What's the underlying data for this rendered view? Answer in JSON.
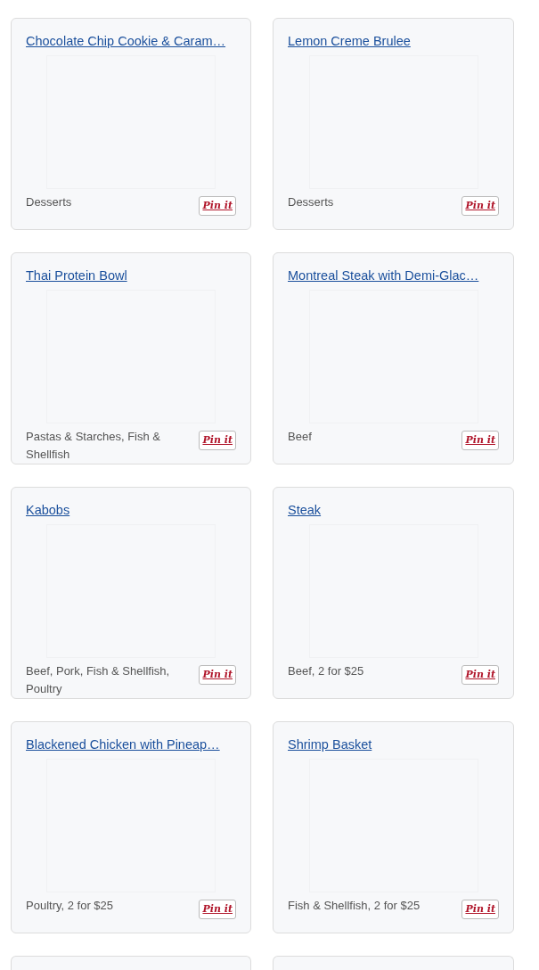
{
  "cards": [
    {
      "kind": "recipe",
      "title": "Chocolate Chip Cookie & Caram…",
      "category": "Desserts",
      "pin_label": "Pin it"
    },
    {
      "kind": "recipe",
      "title": "Lemon Creme Brulee",
      "category": "Desserts",
      "pin_label": "Pin it"
    },
    {
      "kind": "recipe",
      "title": "Thai Protein Bowl",
      "category": "Pastas & Starches, Fish & Shellfish",
      "pin_label": "Pin it"
    },
    {
      "kind": "recipe",
      "title": "Montreal Steak with Demi-Glac…",
      "category": "Beef",
      "pin_label": "Pin it"
    },
    {
      "kind": "recipe",
      "title": "Kabobs",
      "category": "Beef, Pork, Fish & Shellfish, Poultry",
      "pin_label": "Pin it"
    },
    {
      "kind": "recipe",
      "title": "Steak",
      "category": "Beef, 2 for $25",
      "pin_label": "Pin it"
    },
    {
      "kind": "recipe",
      "title": "Blackened Chicken with Pineap…",
      "category": "Poultry, 2 for $25",
      "pin_label": "Pin it"
    },
    {
      "kind": "recipe",
      "title": "Shrimp Basket",
      "category": "Fish & Shellfish, 2 for $25",
      "pin_label": "Pin it"
    },
    {
      "kind": "cut"
    },
    {
      "kind": "cut"
    }
  ]
}
